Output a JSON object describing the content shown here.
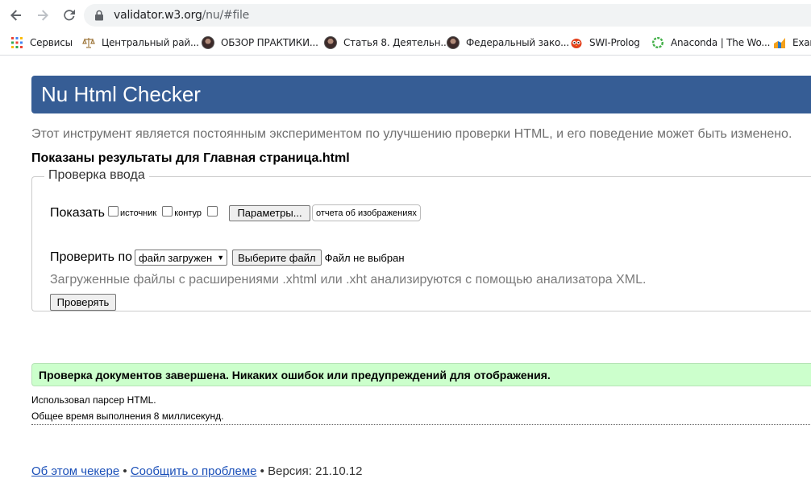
{
  "browser": {
    "url_host": "validator.w3.org",
    "url_path": "/nu/#file",
    "bookmarks": [
      {
        "label": "Сервисы",
        "icon": "apps-grid-icon"
      },
      {
        "label": "Центральный рай...",
        "icon": "scales-icon"
      },
      {
        "label": "ОБЗОР ПРАКТИКИ...",
        "icon": "avatar-icon"
      },
      {
        "label": "Статья 8. Деятельн...",
        "icon": "avatar-icon"
      },
      {
        "label": "Федеральный зако...",
        "icon": "avatar-icon"
      },
      {
        "label": "SWI-Prolog",
        "icon": "owl-icon"
      },
      {
        "label": "Anaconda | The Wo...",
        "icon": "anaconda-ring-icon"
      },
      {
        "label": "Exar",
        "icon": "chart-logo-icon"
      }
    ]
  },
  "header": {
    "title": "Nu Html Checker"
  },
  "intro": "Этот инструмент является постоянным экспериментом по улучшению проверки HTML, и его поведение может быть изменено.",
  "results_for": "Показаны результаты для Главная страница.html",
  "form": {
    "legend": "Проверка ввода",
    "show_label": "Показать",
    "opt_source": "источник",
    "opt_outline": "контур",
    "params_button": "Параметры...",
    "image_report": "отчета об изображениях",
    "check_by_label": "Проверить по",
    "check_by_value": "файл загружен",
    "choose_file_button": "Выберите файл",
    "no_file_text": "Файл не выбран",
    "hint": "Загруженные файлы с расширениями .xhtml или .xht анализируются с помощью анализатора XML.",
    "submit_button": "Проверять"
  },
  "result": {
    "success": "Проверка документов завершена. Никаких ошибок или предупреждений для отображения.",
    "parser": "Использовал парсер HTML.",
    "time": "Общее время выполнения 8 миллисекунд."
  },
  "footer": {
    "about": "Об этом чекере",
    "sep": "•",
    "report": "Сообщить о проблеме",
    "version": "Версия: 21.10.12"
  },
  "colors": {
    "header_bg": "#365d95",
    "success_bg": "#ccffcc",
    "link": "#1a4fb8"
  }
}
